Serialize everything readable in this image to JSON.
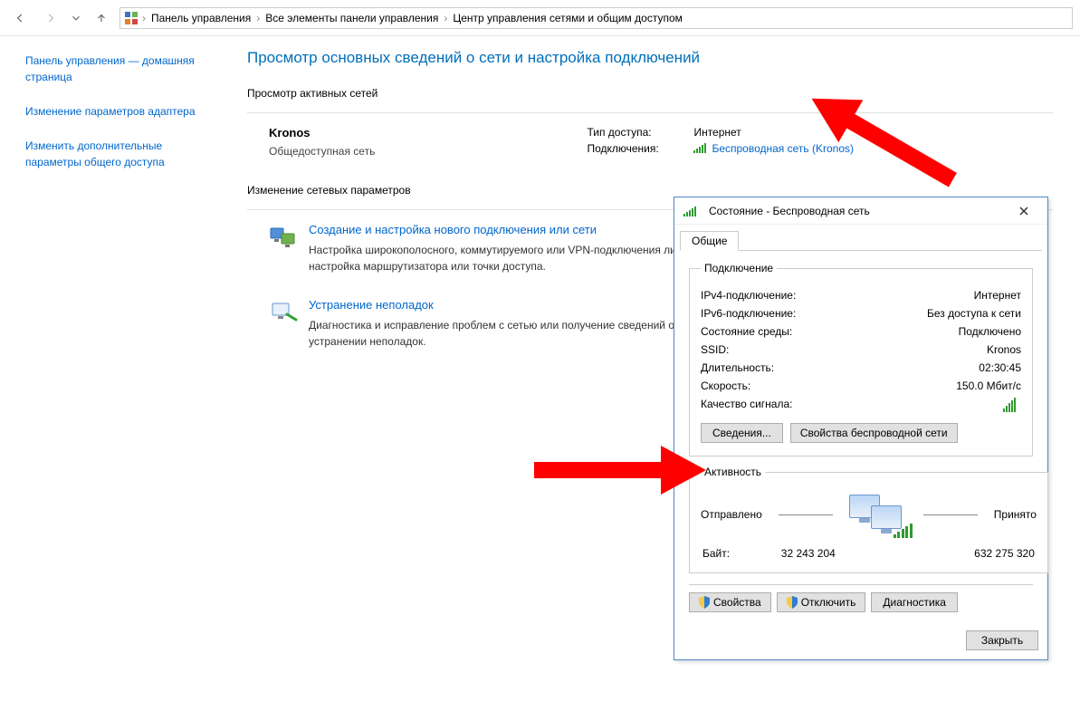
{
  "breadcrumbs": {
    "root": "Панель управления",
    "all": "Все элементы панели управления",
    "current": "Центр управления сетями и общим доступом"
  },
  "sidebar": {
    "home": "Панель управления — домашняя страница",
    "adapter": "Изменение параметров адаптера",
    "sharing": "Изменить дополнительные параметры общего доступа"
  },
  "main": {
    "heading": "Просмотр основных сведений о сети и настройка подключений",
    "active_title": "Просмотр активных сетей",
    "network_name": "Kronos",
    "network_type": "Общедоступная сеть",
    "access_label": "Тип доступа:",
    "access_value": "Интернет",
    "conn_label": "Подключения:",
    "conn_value": "Беспроводная сеть (Kronos)",
    "change_title": "Изменение сетевых параметров",
    "item1_title": "Создание и настройка нового подключения или сети",
    "item1_desc": "Настройка широкополосного, коммутируемого или VPN-подключения либо настройка маршрутизатора или точки доступа.",
    "item2_title": "Устранение неполадок",
    "item2_desc": "Диагностика и исправление проблем с сетью или получение сведений об устранении неполадок."
  },
  "dialog": {
    "title": "Состояние - Беспроводная сеть",
    "tab": "Общие",
    "group_conn": "Подключение",
    "ipv4_k": "IPv4-подключение:",
    "ipv4_v": "Интернет",
    "ipv6_k": "IPv6-подключение:",
    "ipv6_v": "Без доступа к сети",
    "media_k": "Состояние среды:",
    "media_v": "Подключено",
    "ssid_k": "SSID:",
    "ssid_v": "Kronos",
    "dur_k": "Длительность:",
    "dur_v": "02:30:45",
    "speed_k": "Скорость:",
    "speed_v": "150.0 Мбит/с",
    "signal_k": "Качество сигнала:",
    "btn_details": "Сведения...",
    "btn_wprops": "Свойства беспроводной сети",
    "group_act": "Активность",
    "sent": "Отправлено",
    "recv": "Принято",
    "bytes_label": "Байт:",
    "bytes_sent": "32 243 204",
    "bytes_recv": "632 275 320",
    "btn_props": "Свойства",
    "btn_disable": "Отключить",
    "btn_diag": "Диагностика",
    "btn_close": "Закрыть"
  }
}
